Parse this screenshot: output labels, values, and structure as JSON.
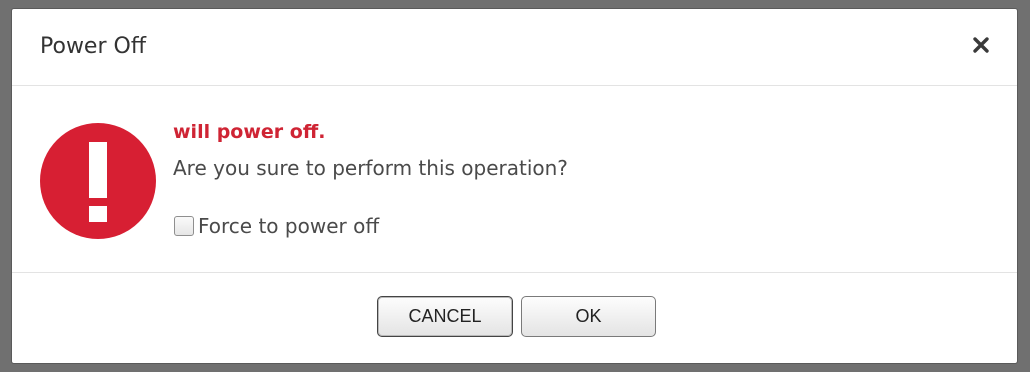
{
  "dialog": {
    "title": "Power Off",
    "close_icon": "close-icon"
  },
  "message": {
    "icon": "exclamation-icon",
    "icon_color": "#d71f33",
    "title": "will power off.",
    "title_color": "#cf2434",
    "text": "Are you sure to perform this operation?"
  },
  "option": {
    "force_label": "Force to power off",
    "force_checked": false
  },
  "buttons": {
    "cancel_label": "CANCEL",
    "ok_label": "OK"
  }
}
